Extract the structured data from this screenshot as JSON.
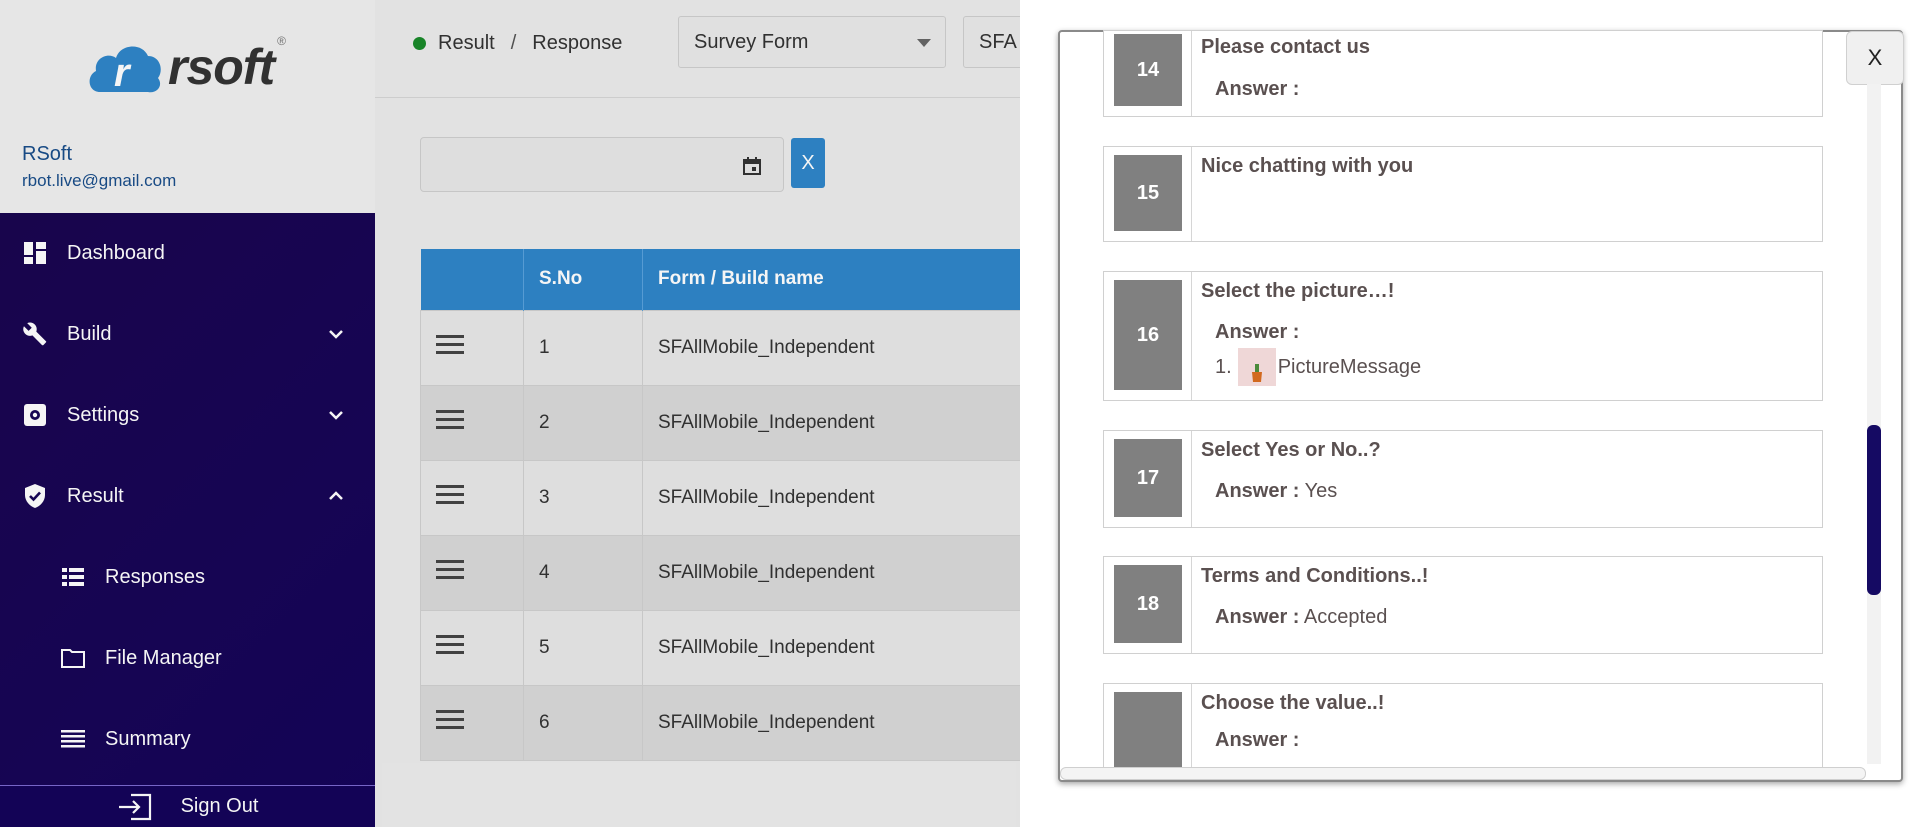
{
  "sidebar": {
    "logo_text": "rsoft",
    "logo_reg": "®",
    "user_name": "RSoft",
    "user_email": "rbot.live@gmail.com",
    "items": [
      {
        "label": "Dashboard",
        "icon": "dashboard-icon"
      },
      {
        "label": "Build",
        "icon": "wrench-icon"
      },
      {
        "label": "Settings",
        "icon": "settings-icon"
      },
      {
        "label": "Result",
        "icon": "shield-icon"
      },
      {
        "label": "Responses",
        "icon": "list-icon"
      },
      {
        "label": "File Manager",
        "icon": "folder-icon"
      },
      {
        "label": "Summary",
        "icon": "lines-icon"
      }
    ],
    "signout_label": "Sign Out"
  },
  "header": {
    "breadcrumb": [
      "Result",
      "Response"
    ],
    "breadcrumb_sep": "/",
    "survey_select": "Survey Form",
    "form_select": "SFA"
  },
  "filter": {
    "date_value": "",
    "clear_label": "X"
  },
  "table": {
    "headers": [
      "",
      "S.No",
      "Form / Build name"
    ],
    "rows": [
      {
        "sno": "1",
        "name": "SFAllMobile_Independent"
      },
      {
        "sno": "2",
        "name": "SFAllMobile_Independent"
      },
      {
        "sno": "3",
        "name": "SFAllMobile_Independent"
      },
      {
        "sno": "4",
        "name": "SFAllMobile_Independent"
      },
      {
        "sno": "5",
        "name": "SFAllMobile_Independent"
      },
      {
        "sno": "6",
        "name": "SFAllMobile_Independent"
      }
    ]
  },
  "modal": {
    "close_label": "X",
    "answer_label": "Answer :",
    "cards": [
      {
        "num": "14",
        "question": "Please contact us",
        "answer": ""
      },
      {
        "num": "15",
        "question": "Nice chatting with you"
      },
      {
        "num": "16",
        "question": "Select the picture…!",
        "answer": "",
        "pic_index": "1.",
        "pic_label": "PictureMessage"
      },
      {
        "num": "17",
        "question": "Select Yes or No..?",
        "answer": "Yes"
      },
      {
        "num": "18",
        "question": "Terms and Conditions..!",
        "answer": "Accepted"
      },
      {
        "num": "",
        "question": "Choose the value..!",
        "answer": ""
      }
    ]
  },
  "colors": {
    "accent_blue": "#2f86c9",
    "sidebar_dark": "#170657",
    "status_green": "#1a8a2a",
    "num_badge": "#808080"
  }
}
